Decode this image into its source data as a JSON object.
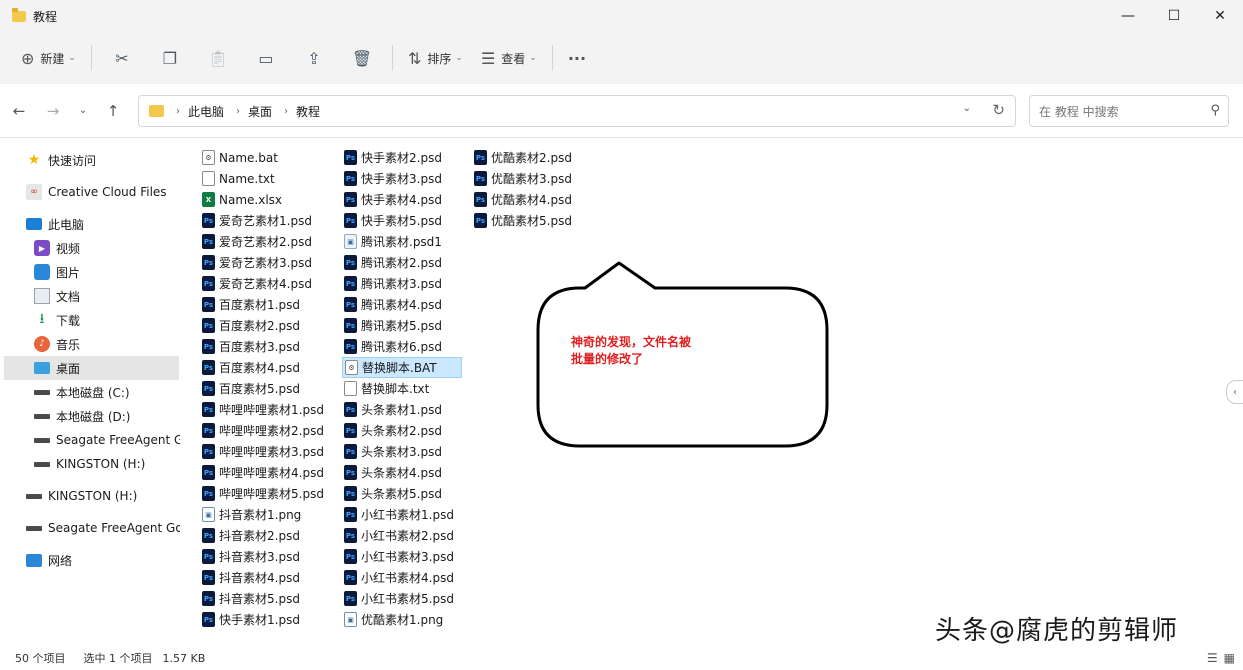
{
  "window": {
    "title": "教程",
    "controls": {
      "minimize": "—",
      "maximize": "☐",
      "close": "✕"
    }
  },
  "toolbar": {
    "new_label": "新建",
    "sort_label": "排序",
    "view_label": "查看",
    "more_label": "···"
  },
  "address": {
    "crumbs": [
      "此电脑",
      "桌面",
      "教程"
    ]
  },
  "search": {
    "placeholder": "在 教程 中搜索"
  },
  "sidebar": {
    "items": [
      {
        "label": "快速访问",
        "icon": "star-icon"
      },
      {
        "label": "Creative Cloud Files",
        "icon": "creative-cloud-icon"
      },
      {
        "label": "此电脑",
        "icon": "computer-icon"
      },
      {
        "label": "视频",
        "icon": "video-icon"
      },
      {
        "label": "图片",
        "icon": "picture-icon"
      },
      {
        "label": "文档",
        "icon": "document-icon"
      },
      {
        "label": "下载",
        "icon": "download-icon"
      },
      {
        "label": "音乐",
        "icon": "music-icon"
      },
      {
        "label": "桌面",
        "icon": "desktop-icon",
        "selected": true
      },
      {
        "label": "本地磁盘 (C:)",
        "icon": "drive-icon"
      },
      {
        "label": "本地磁盘 (D:)",
        "icon": "drive-icon"
      },
      {
        "label": "Seagate FreeAgent G",
        "icon": "drive-icon"
      },
      {
        "label": "KINGSTON (H:)",
        "icon": "drive-icon"
      },
      {
        "label": "KINGSTON (H:)",
        "icon": "drive-icon"
      },
      {
        "label": "Seagate FreeAgent Go",
        "icon": "drive-icon"
      },
      {
        "label": "网络",
        "icon": "network-icon"
      }
    ]
  },
  "files": {
    "col1": [
      {
        "name": "Name.bat",
        "type": "bat"
      },
      {
        "name": "Name.txt",
        "type": "txt"
      },
      {
        "name": "Name.xlsx",
        "type": "xlsx"
      },
      {
        "name": "爱奇艺素材1.psd",
        "type": "psd"
      },
      {
        "name": "爱奇艺素材2.psd",
        "type": "psd"
      },
      {
        "name": "爱奇艺素材3.psd",
        "type": "psd"
      },
      {
        "name": "爱奇艺素材4.psd",
        "type": "psd"
      },
      {
        "name": "百度素材1.psd",
        "type": "psd"
      },
      {
        "name": "百度素材2.psd",
        "type": "psd"
      },
      {
        "name": "百度素材3.psd",
        "type": "psd"
      },
      {
        "name": "百度素材4.psd",
        "type": "psd"
      },
      {
        "name": "百度素材5.psd",
        "type": "psd"
      },
      {
        "name": "哔哩哔哩素材1.psd",
        "type": "psd"
      },
      {
        "name": "哔哩哔哩素材2.psd",
        "type": "psd"
      },
      {
        "name": "哔哩哔哩素材3.psd",
        "type": "psd"
      },
      {
        "name": "哔哩哔哩素材4.psd",
        "type": "psd"
      },
      {
        "name": "哔哩哔哩素材5.psd",
        "type": "psd"
      },
      {
        "name": "抖音素材1.png",
        "type": "png"
      },
      {
        "name": "抖音素材2.psd",
        "type": "psd"
      },
      {
        "name": "抖音素材3.psd",
        "type": "psd"
      },
      {
        "name": "抖音素材4.psd",
        "type": "psd"
      },
      {
        "name": "抖音素材5.psd",
        "type": "psd"
      },
      {
        "name": "快手素材1.psd",
        "type": "psd"
      }
    ],
    "col2": [
      {
        "name": "快手素材2.psd",
        "type": "psd"
      },
      {
        "name": "快手素材3.psd",
        "type": "psd"
      },
      {
        "name": "快手素材4.psd",
        "type": "psd"
      },
      {
        "name": "快手素材5.psd",
        "type": "psd"
      },
      {
        "name": "腾讯素材.psd1",
        "type": "psd1"
      },
      {
        "name": "腾讯素材2.psd",
        "type": "psd"
      },
      {
        "name": "腾讯素材3.psd",
        "type": "psd"
      },
      {
        "name": "腾讯素材4.psd",
        "type": "psd"
      },
      {
        "name": "腾讯素材5.psd",
        "type": "psd"
      },
      {
        "name": "腾讯素材6.psd",
        "type": "psd"
      },
      {
        "name": "替换脚本.BAT",
        "type": "bat",
        "selected": true
      },
      {
        "name": "替换脚本.txt",
        "type": "txt"
      },
      {
        "name": "头条素材1.psd",
        "type": "psd"
      },
      {
        "name": "头条素材2.psd",
        "type": "psd"
      },
      {
        "name": "头条素材3.psd",
        "type": "psd"
      },
      {
        "name": "头条素材4.psd",
        "type": "psd"
      },
      {
        "name": "头条素材5.psd",
        "type": "psd"
      },
      {
        "name": "小红书素材1.psd",
        "type": "psd"
      },
      {
        "name": "小红书素材2.psd",
        "type": "psd"
      },
      {
        "name": "小红书素材3.psd",
        "type": "psd"
      },
      {
        "name": "小红书素材4.psd",
        "type": "psd"
      },
      {
        "name": "小红书素材5.psd",
        "type": "psd"
      },
      {
        "name": "优酷素材1.png",
        "type": "png"
      }
    ],
    "col3": [
      {
        "name": "优酷素材2.psd",
        "type": "psd"
      },
      {
        "name": "优酷素材3.psd",
        "type": "psd"
      },
      {
        "name": "优酷素材4.psd",
        "type": "psd"
      },
      {
        "name": "优酷素材5.psd",
        "type": "psd"
      }
    ]
  },
  "callout": {
    "line1": "神奇的发现，文件名被",
    "line2": "批量的修改了",
    "color": "#e02020"
  },
  "status": {
    "count": "50 个项目",
    "selection": "选中 1 个项目",
    "size": "1.57 KB"
  },
  "watermark": "头条@腐虎的剪辑师"
}
